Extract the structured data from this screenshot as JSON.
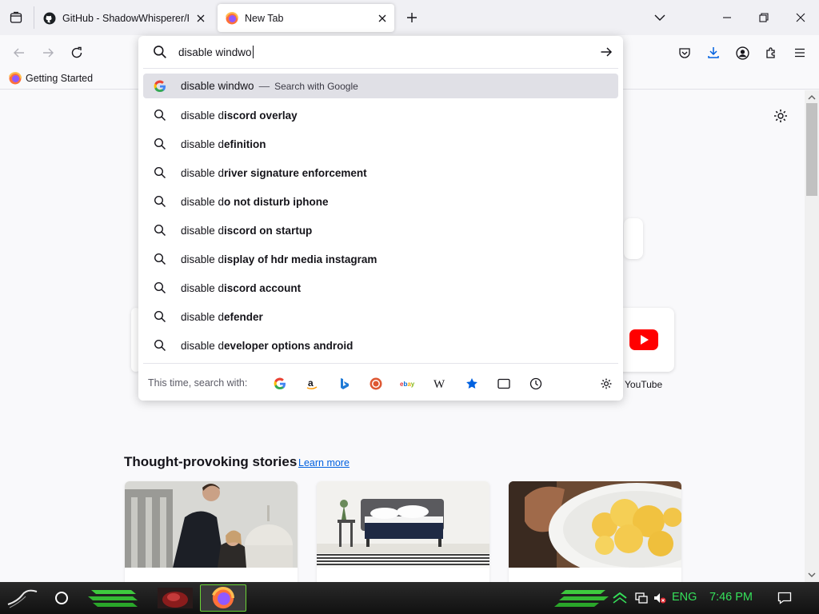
{
  "tabs": [
    {
      "title": "GitHub - ShadowWhisperer/Remove-Ms-Edge",
      "favicon": "github-icon",
      "active": false
    },
    {
      "title": "New Tab",
      "favicon": "firefox-icon",
      "active": true
    }
  ],
  "bookmarks": [
    {
      "label": "Getting Started",
      "favicon": "firefox-icon"
    }
  ],
  "urlbar": {
    "typed": "disable windwo",
    "heuristic": {
      "text": "disable windwo",
      "separator": "—",
      "action": "Search with Google",
      "engine_icon": "google-icon"
    },
    "suggestions": [
      {
        "prefix": "disable d",
        "suffix": "iscord overlay"
      },
      {
        "prefix": "disable d",
        "suffix": "efinition"
      },
      {
        "prefix": "disable d",
        "suffix": "river signature enforcement"
      },
      {
        "prefix": "disable d",
        "suffix": "o not disturb iphone"
      },
      {
        "prefix": "disable d",
        "suffix": "iscord on startup"
      },
      {
        "prefix": "disable d",
        "suffix": "isplay of hdr media instagram"
      },
      {
        "prefix": "disable d",
        "suffix": "iscord account"
      },
      {
        "prefix": "disable d",
        "suffix": "efender"
      },
      {
        "prefix": "disable d",
        "suffix": "eveloper options android"
      }
    ],
    "oneoff_label": "This time, search with:",
    "oneoff_engines": [
      "google-icon",
      "amazon-icon",
      "bing-icon",
      "duckduckgo-icon",
      "ebay-icon",
      "wikipedia-icon",
      "bookmarks-star-icon",
      "tabs-icon",
      "history-clock-icon"
    ]
  },
  "newtab": {
    "top_site_label": "YouTube",
    "stories_title": "Thought-provoking stories",
    "learn_more": "Learn more"
  },
  "taskbar": {
    "language": "ENG",
    "time": "7:46 PM"
  },
  "colors": {
    "accent": "#0061e0",
    "tray_green": "#35e05a",
    "highlight_row": "#e0e0e6"
  }
}
